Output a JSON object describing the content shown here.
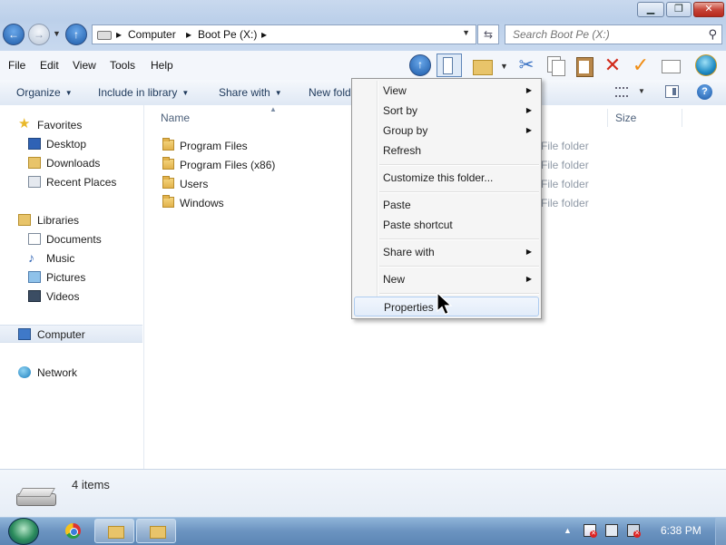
{
  "window": {
    "minimize_glyph": "▁",
    "maximize_glyph": "❐",
    "close_glyph": "✕"
  },
  "address": {
    "crumbs": [
      "Computer",
      "Boot Pe (X:)"
    ],
    "separator": "▸",
    "search_placeholder": "Search Boot Pe (X:)"
  },
  "menu": {
    "items": [
      "File",
      "Edit",
      "View",
      "Tools",
      "Help"
    ]
  },
  "command_bar": {
    "organize": "Organize",
    "include_in_library": "Include in library",
    "share_with": "Share with",
    "new_folder": "New folder"
  },
  "navigation": {
    "favorites": "Favorites",
    "desktop": "Desktop",
    "downloads": "Downloads",
    "recent_places": "Recent Places",
    "libraries": "Libraries",
    "documents": "Documents",
    "music": "Music",
    "pictures": "Pictures",
    "videos": "Videos",
    "computer": "Computer",
    "network": "Network"
  },
  "file_list": {
    "columns": {
      "name": "Name",
      "size": "Size"
    },
    "files": [
      {
        "name": "Program Files",
        "type": "File folder"
      },
      {
        "name": "Program Files (x86)",
        "type": "File folder"
      },
      {
        "name": "Users",
        "type": "File folder"
      },
      {
        "name": "Windows",
        "type": "File folder"
      }
    ]
  },
  "context_menu": {
    "items": [
      {
        "label": "View",
        "submenu": true
      },
      {
        "label": "Sort by",
        "submenu": true
      },
      {
        "label": "Group by",
        "submenu": true
      },
      {
        "label": "Refresh",
        "submenu": false
      },
      {
        "label": "Customize this folder...",
        "submenu": false
      },
      {
        "label": "Paste",
        "submenu": false
      },
      {
        "label": "Paste shortcut",
        "submenu": false
      },
      {
        "label": "Share with",
        "submenu": true
      },
      {
        "label": "New",
        "submenu": true
      },
      {
        "label": "Properties",
        "submenu": false,
        "hovered": true
      }
    ],
    "submenu_glyph": "▶"
  },
  "details": {
    "item_count": "4 items"
  },
  "taskbar": {
    "clock": "6:38 PM"
  },
  "colors": {
    "accent": "#1c5aa8",
    "menu_hover": "#aeccf0",
    "taskbar": "#6b93c0"
  }
}
